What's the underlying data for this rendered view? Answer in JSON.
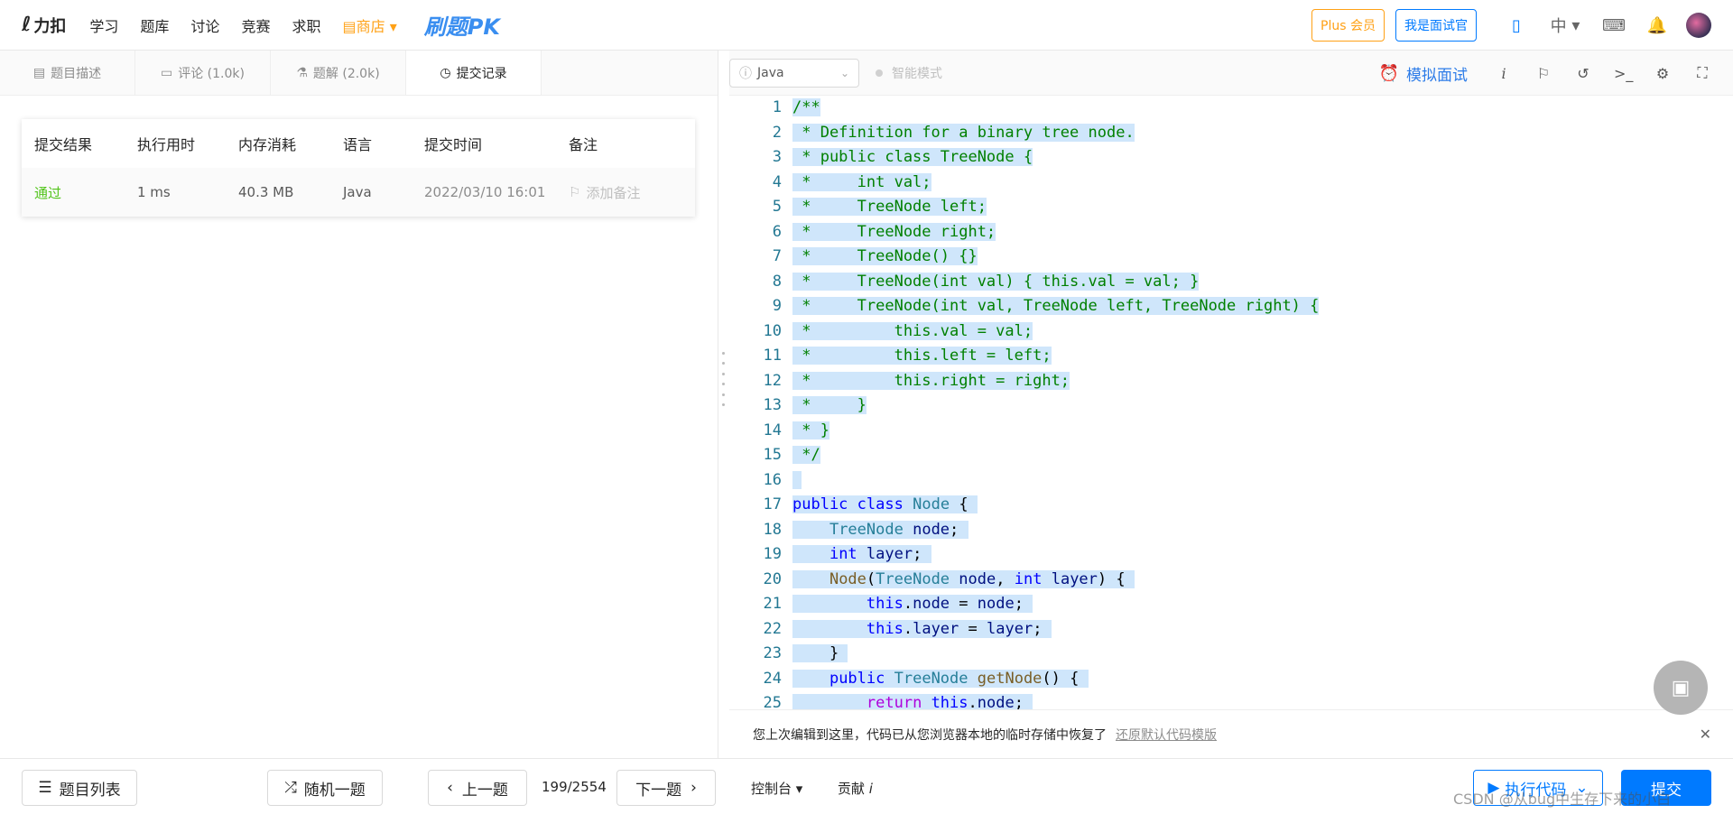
{
  "nav": {
    "logo_text": "力扣",
    "items": [
      "学习",
      "题库",
      "讨论",
      "竞赛",
      "求职"
    ],
    "store": "商店",
    "pk": "刷题",
    "pk_suffix": "PK",
    "plus": "Plus 会员",
    "interviewer": "我是面试官",
    "lang": "中"
  },
  "tabs": [
    {
      "label": "题目描述"
    },
    {
      "label": "评论 (1.0k)"
    },
    {
      "label": "题解 (2.0k)"
    },
    {
      "label": "提交记录"
    }
  ],
  "submissions": {
    "headers": [
      "提交结果",
      "执行用时",
      "内存消耗",
      "语言",
      "提交时间",
      "备注"
    ],
    "row": {
      "result": "通过",
      "time": "1 ms",
      "memory": "40.3 MB",
      "lang": "Java",
      "submitted": "2022/03/10 16:01",
      "note": "添加备注"
    }
  },
  "editor": {
    "language": "Java",
    "smart_mode": "智能模式",
    "mock_interview": "模拟面试",
    "line_numbers": [
      "1",
      "2",
      "3",
      "4",
      "5",
      "6",
      "7",
      "8",
      "9",
      "10",
      "11",
      "12",
      "13",
      "14",
      "15",
      "16",
      "17",
      "18",
      "19",
      "20",
      "21",
      "22",
      "23",
      "24",
      "25"
    ],
    "notice": "您上次编辑到这里，代码已从您浏览器本地的临时存储中恢复了",
    "restore": "还原默认代码模版"
  },
  "bottom": {
    "list": "题目列表",
    "random": "随机一题",
    "prev": "上一题",
    "count": "199/2554",
    "next": "下一题",
    "console": "控制台",
    "contrib": "贡献",
    "run": "执行代码",
    "submit": "提交"
  },
  "watermark": "CSDN @从bug中生存下来的小白"
}
